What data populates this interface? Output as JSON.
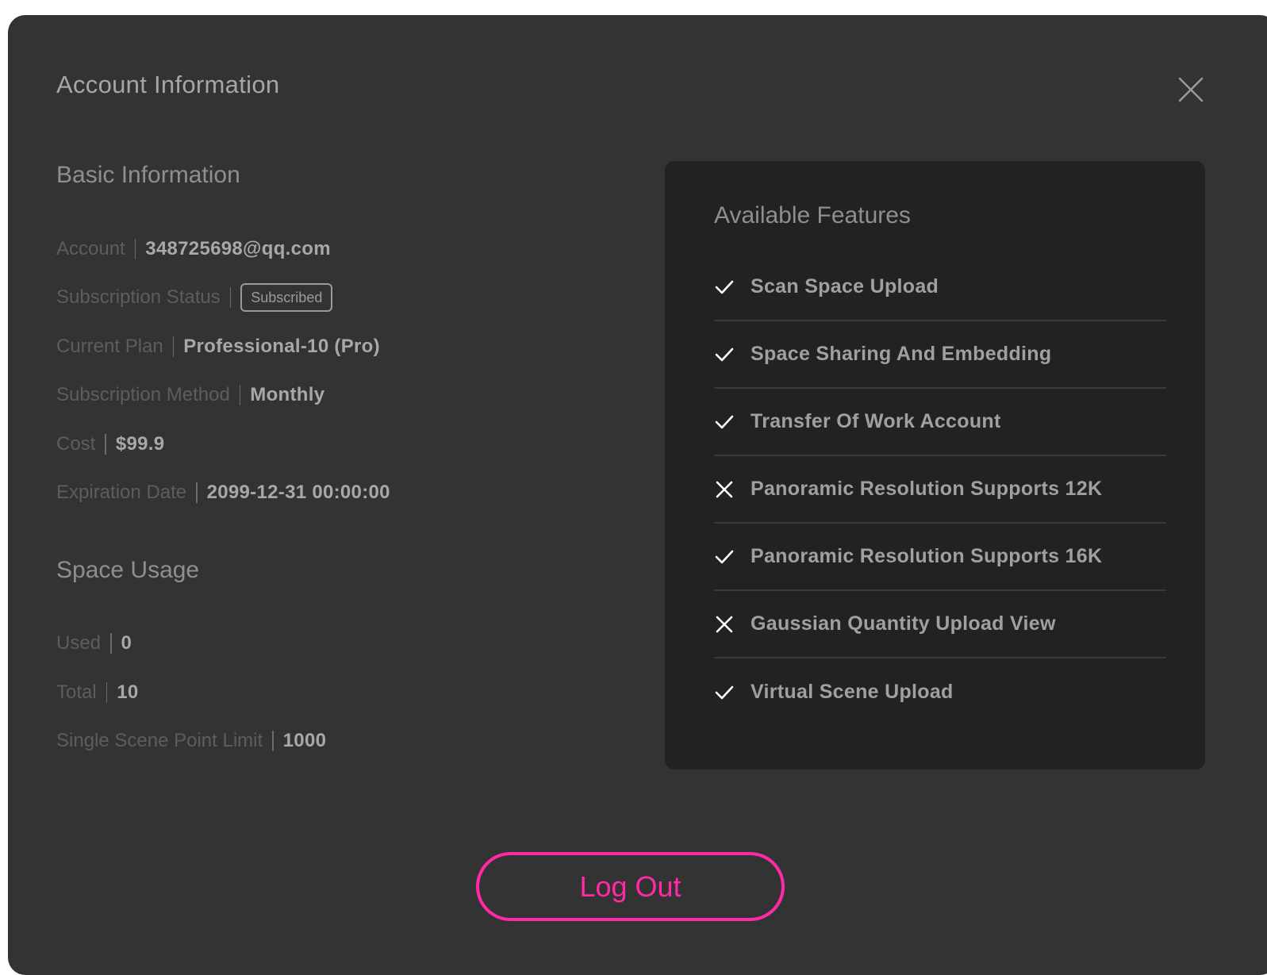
{
  "modal": {
    "title": "Account Information",
    "close_icon": "close-icon"
  },
  "basic_info": {
    "heading": "Basic Information",
    "rows": [
      {
        "label": "Account",
        "value": "348725698@qq.com"
      },
      {
        "label": "Subscription Status",
        "value": "Subscribed",
        "type": "badge"
      },
      {
        "label": "Current Plan",
        "value": "Professional-10 (Pro)"
      },
      {
        "label": "Subscription Method",
        "value": "Monthly"
      },
      {
        "label": "Cost",
        "value": "$99.9"
      },
      {
        "label": "Expiration Date",
        "value": "2099-12-31 00:00:00"
      }
    ]
  },
  "space_usage": {
    "heading": "Space Usage",
    "rows": [
      {
        "label": "Used",
        "value": "0"
      },
      {
        "label": "Total",
        "value": "10"
      },
      {
        "label": "Single Scene Point Limit",
        "value": "1000"
      }
    ]
  },
  "features": {
    "heading": "Available Features",
    "items": [
      {
        "label": "Scan Space Upload",
        "available": true,
        "icon": "check-icon"
      },
      {
        "label": "Space Sharing And Embedding",
        "available": true,
        "icon": "check-icon"
      },
      {
        "label": "Transfer Of Work Account",
        "available": true,
        "icon": "check-icon"
      },
      {
        "label": "Panoramic Resolution Supports 12K",
        "available": false,
        "icon": "cross-icon"
      },
      {
        "label": "Panoramic Resolution Supports 16K",
        "available": true,
        "icon": "check-icon"
      },
      {
        "label": "Gaussian Quantity Upload View",
        "available": false,
        "icon": "cross-icon"
      },
      {
        "label": "Virtual Scene Upload",
        "available": true,
        "icon": "check-icon"
      }
    ]
  },
  "actions": {
    "logout_label": "Log Out"
  },
  "colors": {
    "modal_bg": "#333333",
    "panel_bg": "#222222",
    "accent": "#ff2aa4"
  }
}
